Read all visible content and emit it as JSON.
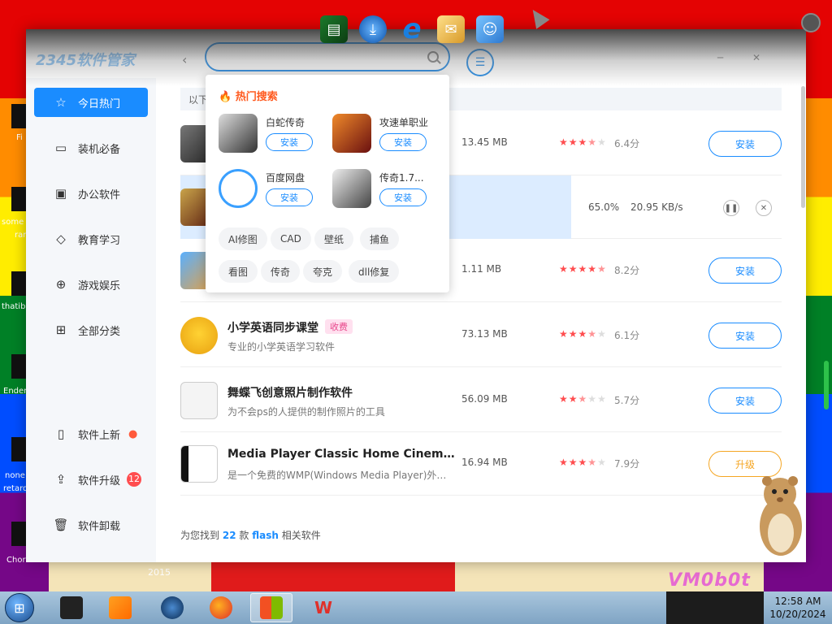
{
  "desktop": {
    "labels": [
      "Fi",
      "some",
      "ran",
      "thatib",
      "Ender",
      "none",
      "retard",
      "Chor"
    ],
    "year": "2015",
    "watermark": "VM0b0t"
  },
  "app": {
    "logo": "2345软件管家",
    "search": {
      "value": "",
      "placeholder": ""
    },
    "sidebar": {
      "items": [
        {
          "label": "今日热门",
          "icon": "star-icon"
        },
        {
          "label": "装机必备",
          "icon": "monitor-icon"
        },
        {
          "label": "办公软件",
          "icon": "briefcase-icon"
        },
        {
          "label": "教育学习",
          "icon": "graduation-cap-icon"
        },
        {
          "label": "游戏娱乐",
          "icon": "gamepad-icon"
        },
        {
          "label": "全部分类",
          "icon": "grid-icon"
        }
      ],
      "bottom": [
        {
          "label": "软件上新",
          "icon": "bookmark-icon"
        },
        {
          "label": "软件升级",
          "icon": "upload-icon",
          "badge": "12"
        },
        {
          "label": "软件卸载",
          "icon": "trash-icon"
        }
      ]
    },
    "notice": "以下",
    "rows": [
      {
        "name": "",
        "desc": "",
        "size": "13.45 MB",
        "stars": 3.5,
        "score": "6.4分",
        "action": "安装"
      },
      {
        "downloading": true,
        "percent": "65.0%",
        "progress": 0.65,
        "speed": "20.95 KB/s"
      },
      {
        "name": "",
        "desc": "",
        "size": "1.11 MB",
        "stars": 4.5,
        "score": "8.2分",
        "action": "安装"
      },
      {
        "name": "小学英语同步课堂",
        "tag": "收费",
        "desc": "专业的小学英语学习软件",
        "size": "73.13 MB",
        "stars": 3.5,
        "score": "6.1分",
        "action": "安装"
      },
      {
        "name": "舞蝶飞创意照片制作软件",
        "desc": "为不会ps的人提供的制作照片的工具",
        "size": "56.09 MB",
        "stars": 2.5,
        "score": "5.7分",
        "action": "安装"
      },
      {
        "name": "Media Player Classic Home Cinema ( M...",
        "desc": "是一个免费的WMP(Windows Media Player)外壳...",
        "size": "16.94 MB",
        "stars": 3.5,
        "score": "7.9分",
        "action": "升级"
      }
    ],
    "footer": {
      "prefix": "为您找到",
      "count": "22",
      "unit": "款",
      "keyword": "flash",
      "suffix": "相关软件"
    },
    "popup": {
      "title": "热门搜索",
      "apps": [
        {
          "name": "白蛇传奇",
          "button": "安装"
        },
        {
          "name": "攻速单职业",
          "button": "安装"
        },
        {
          "name": "百度网盘",
          "button": "安装"
        },
        {
          "name": "传奇1.7...",
          "button": "安装"
        }
      ],
      "chips": [
        "AI修图",
        "CAD",
        "壁纸",
        "捕鱼",
        "看图",
        "传奇",
        "夸克",
        "dll修复"
      ]
    }
  },
  "taskbar": {
    "time": "12:58 AM",
    "date": "10/20/2024"
  },
  "colors": {
    "accent": "#1a8cff",
    "upgrade": "#f5a623",
    "star": "#ff4d4f",
    "hot": "#ff5a1f"
  }
}
